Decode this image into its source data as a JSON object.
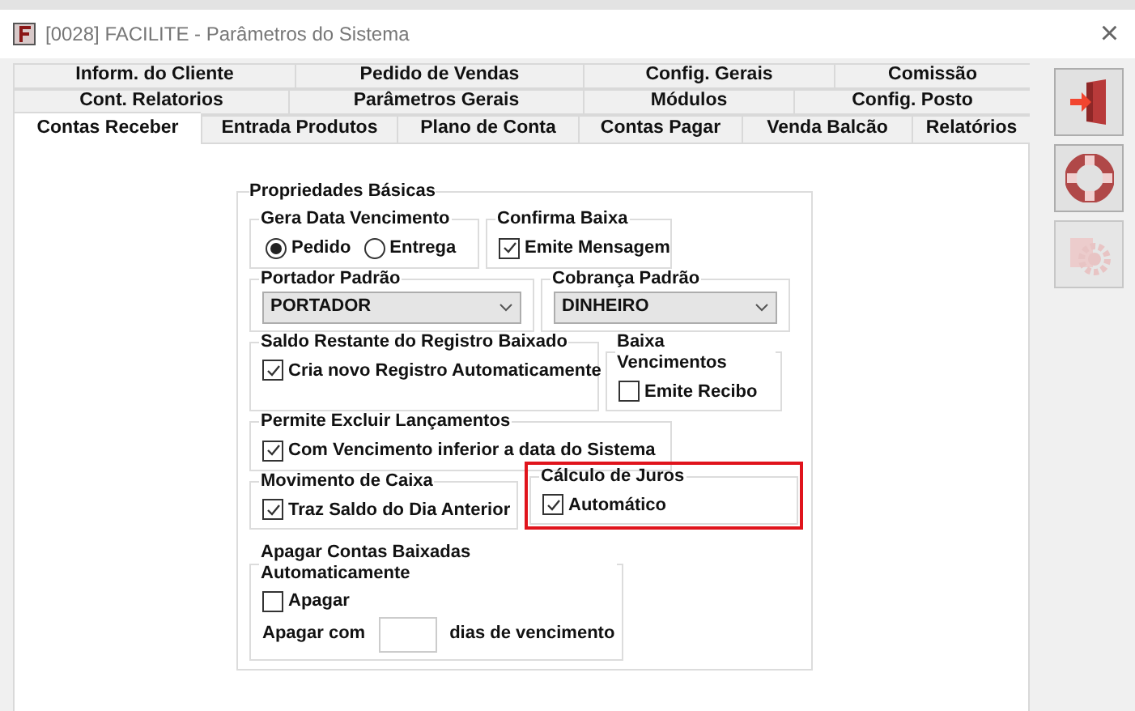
{
  "window": {
    "title": "[0028] FACILITE - Parâmetros do Sistema",
    "close": "×"
  },
  "tab_rows": [
    [
      {
        "label": "Inform. do Cliente",
        "selected": false
      },
      {
        "label": "Pedido de Vendas",
        "selected": false
      },
      {
        "label": "Config. Gerais",
        "selected": false
      },
      {
        "label": "Comissão",
        "selected": false
      }
    ],
    [
      {
        "label": "Cont. Relatorios",
        "selected": false
      },
      {
        "label": "Parâmetros Gerais",
        "selected": false
      },
      {
        "label": "Módulos",
        "selected": false
      },
      {
        "label": "Config. Posto",
        "selected": false
      }
    ],
    [
      {
        "label": "Contas Receber",
        "selected": true
      },
      {
        "label": "Entrada Produtos",
        "selected": false
      },
      {
        "label": "Plano de Conta",
        "selected": false
      },
      {
        "label": "Contas Pagar",
        "selected": false
      },
      {
        "label": "Venda Balcão",
        "selected": false
      },
      {
        "label": "Relatórios",
        "selected": false
      }
    ]
  ],
  "sidebar_buttons": [
    {
      "kind": "exit",
      "disabled": false
    },
    {
      "kind": "help",
      "disabled": false
    },
    {
      "kind": "settings",
      "disabled": true
    }
  ],
  "form": {
    "title": "Propriedades Básicas",
    "rows": [
      [
        {
          "kind": "radio",
          "title": "Gera Data Vencimento",
          "highlighted": false,
          "options": [
            {
              "label": "Pedido",
              "selected": true
            },
            {
              "label": "Entrega",
              "selected": false
            }
          ]
        },
        {
          "kind": "checkbox",
          "title": "Confirma Baixa",
          "highlighted": false,
          "items": [
            {
              "label": "Emite Mensagem",
              "checked": true
            }
          ]
        }
      ],
      [
        {
          "kind": "select",
          "title": "Portador Padrão",
          "highlighted": false,
          "value": "PORTADOR"
        },
        {
          "kind": "select",
          "title": "Cobrança Padrão",
          "highlighted": false,
          "value": "DINHEIRO"
        }
      ],
      [
        {
          "kind": "checkbox",
          "title": "Saldo Restante do Registro Baixado",
          "highlighted": false,
          "items": [
            {
              "label": "Cria novo Registro Automaticamente",
              "checked": true
            }
          ]
        },
        {
          "kind": "checkbox",
          "title": "Baixa Vencimentos",
          "highlighted": false,
          "items": [
            {
              "label": "Emite Recibo",
              "checked": false
            }
          ]
        }
      ],
      [
        {
          "kind": "checkbox",
          "title": "Permite Excluir Lançamentos",
          "highlighted": false,
          "items": [
            {
              "label": "Com Vencimento inferior a data do Sistema",
              "checked": true
            }
          ]
        }
      ],
      [
        {
          "kind": "checkbox",
          "title": "Movimento de Caixa",
          "highlighted": false,
          "items": [
            {
              "label": "Traz Saldo do Dia Anterior",
              "checked": true
            }
          ]
        },
        {
          "kind": "checkbox",
          "title": "Cálculo de Juros",
          "highlighted": true,
          "items": [
            {
              "label": "Automático",
              "checked": true
            }
          ]
        }
      ],
      [
        {
          "kind": "apagar",
          "title": "Apagar Contas Baixadas Automaticamente",
          "highlighted": false,
          "items": [
            {
              "label": "Apagar",
              "checked": false
            }
          ],
          "before": "Apagar com",
          "after": "dias de vencimento"
        }
      ]
    ]
  }
}
